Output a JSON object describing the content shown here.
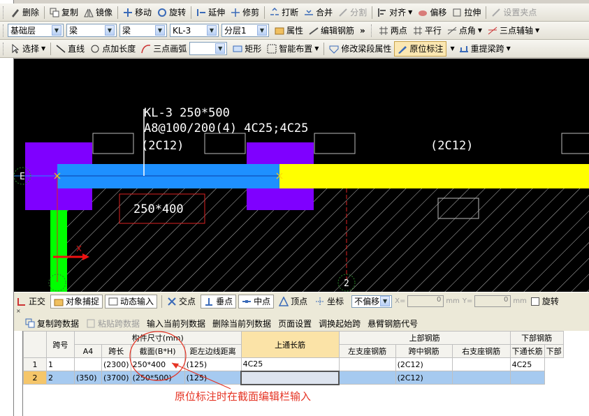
{
  "toolbar1": {
    "items": [
      {
        "label": "删除",
        "icon": "delete-icon"
      },
      {
        "label": "复制",
        "icon": "copy-icon"
      },
      {
        "label": "镜像",
        "icon": "mirror-icon"
      },
      {
        "label": "移动",
        "icon": "move-icon"
      },
      {
        "label": "旋转",
        "icon": "rotate-icon"
      },
      {
        "label": "延伸",
        "icon": "extend-icon"
      },
      {
        "label": "修剪",
        "icon": "trim-icon"
      },
      {
        "label": "打断",
        "icon": "break-icon"
      },
      {
        "label": "合并",
        "icon": "merge-icon"
      },
      {
        "label": "分割",
        "icon": "split-icon",
        "disabled": true
      },
      {
        "label": "对齐",
        "icon": "align-icon",
        "dropdown": true
      },
      {
        "label": "偏移",
        "icon": "offset-icon"
      },
      {
        "label": "拉伸",
        "icon": "stretch-icon"
      },
      {
        "label": "设置夹点",
        "icon": "grip-icon",
        "disabled": true
      }
    ]
  },
  "toolbar2": {
    "selects": [
      "基础层",
      "梁",
      "梁",
      "KL-3",
      "分层1"
    ],
    "property_label": "属性",
    "edit_rebar_label": "编辑钢筋",
    "overflow": "»",
    "right_items": [
      {
        "label": "两点",
        "icon": "two-point-icon"
      },
      {
        "label": "平行",
        "icon": "parallel-icon"
      },
      {
        "label": "点角",
        "icon": "point-angle-icon",
        "dropdown": true
      },
      {
        "label": "三点辅轴",
        "icon": "three-point-axis-icon",
        "dropdown": true
      }
    ]
  },
  "toolbar3": {
    "select_label": "选择",
    "line_label": "直线",
    "point_length_label": "点加长度",
    "arc_label": "三点画弧",
    "rect_label": "矩形",
    "smart_layout_label": "智能布置",
    "modify_span_label": "修改梁段属性",
    "in_situ_label": "原位标注",
    "relift_label": "重提梁跨"
  },
  "drawing": {
    "beam_name": "KL-3 250*500",
    "stirrup": "A8@100/200(4) 4C25;4C25",
    "span_bar_1": "(2C12)",
    "span_bar_2": "(2C12)",
    "section": "250*400",
    "axis_e": "E",
    "axis_2": "2",
    "colors": {
      "background": "#000000",
      "beam_blue": "#1e90ff",
      "beam_yellow": "#ffff00",
      "column_purple": "#7f00ff",
      "wall_green": "#00ff00",
      "annotation_red": "#e53323"
    }
  },
  "statusbar": {
    "ortho": "正交",
    "snap": "对象捕捉",
    "dyn_input": "动态输入",
    "intersection": "交点",
    "perpendicular": "垂点",
    "midpoint": "中点",
    "vertex": "顶点",
    "coordinate": "坐标",
    "offset_mode": "不偏移",
    "x_label": "X=",
    "x_value": "0",
    "y_label": "Y=",
    "y_value": "0",
    "unit": "mm",
    "rotate": "旋转"
  },
  "panel_toolbar": {
    "copy_span": "复制跨数据",
    "paste_span": "粘贴跨数据",
    "input_col": "输入当前列数据",
    "delete_col": "删除当前列数据",
    "page_setup": "页面设置",
    "swap_start": "调换起始跨",
    "cantilever": "悬臂钢筋代号"
  },
  "table": {
    "group_headers": {
      "span_no": "跨号",
      "dims": "构件尺寸(mm)",
      "top_through": "上通长筋",
      "top_rebar": "上部钢筋",
      "bottom_rebar": "下部钢筋"
    },
    "sub_headers": [
      "A4",
      "跨长",
      "截面(B*H)",
      "距左边线距离",
      "左支座钢筋",
      "跨中钢筋",
      "右支座钢筋",
      "下通长筋",
      "下部"
    ],
    "rows": [
      {
        "rn": "1",
        "span": "1",
        "a4": "",
        "len": "(2300)",
        "section": "250*400",
        "dist": "(125)",
        "top_through": "4C25",
        "left": "",
        "mid": "(2C12)",
        "right": "",
        "bot_through": "4C25",
        "bot": ""
      },
      {
        "rn": "2",
        "span": "2",
        "a4": "(350)",
        "len": "(3700)",
        "section": "(250*500)",
        "dist": "(125)",
        "top_through": "",
        "left": "",
        "mid": "(2C12)",
        "right": "",
        "bot_through": "",
        "bot": ""
      }
    ]
  },
  "annotation": "原位标注时在截面编辑栏输入"
}
